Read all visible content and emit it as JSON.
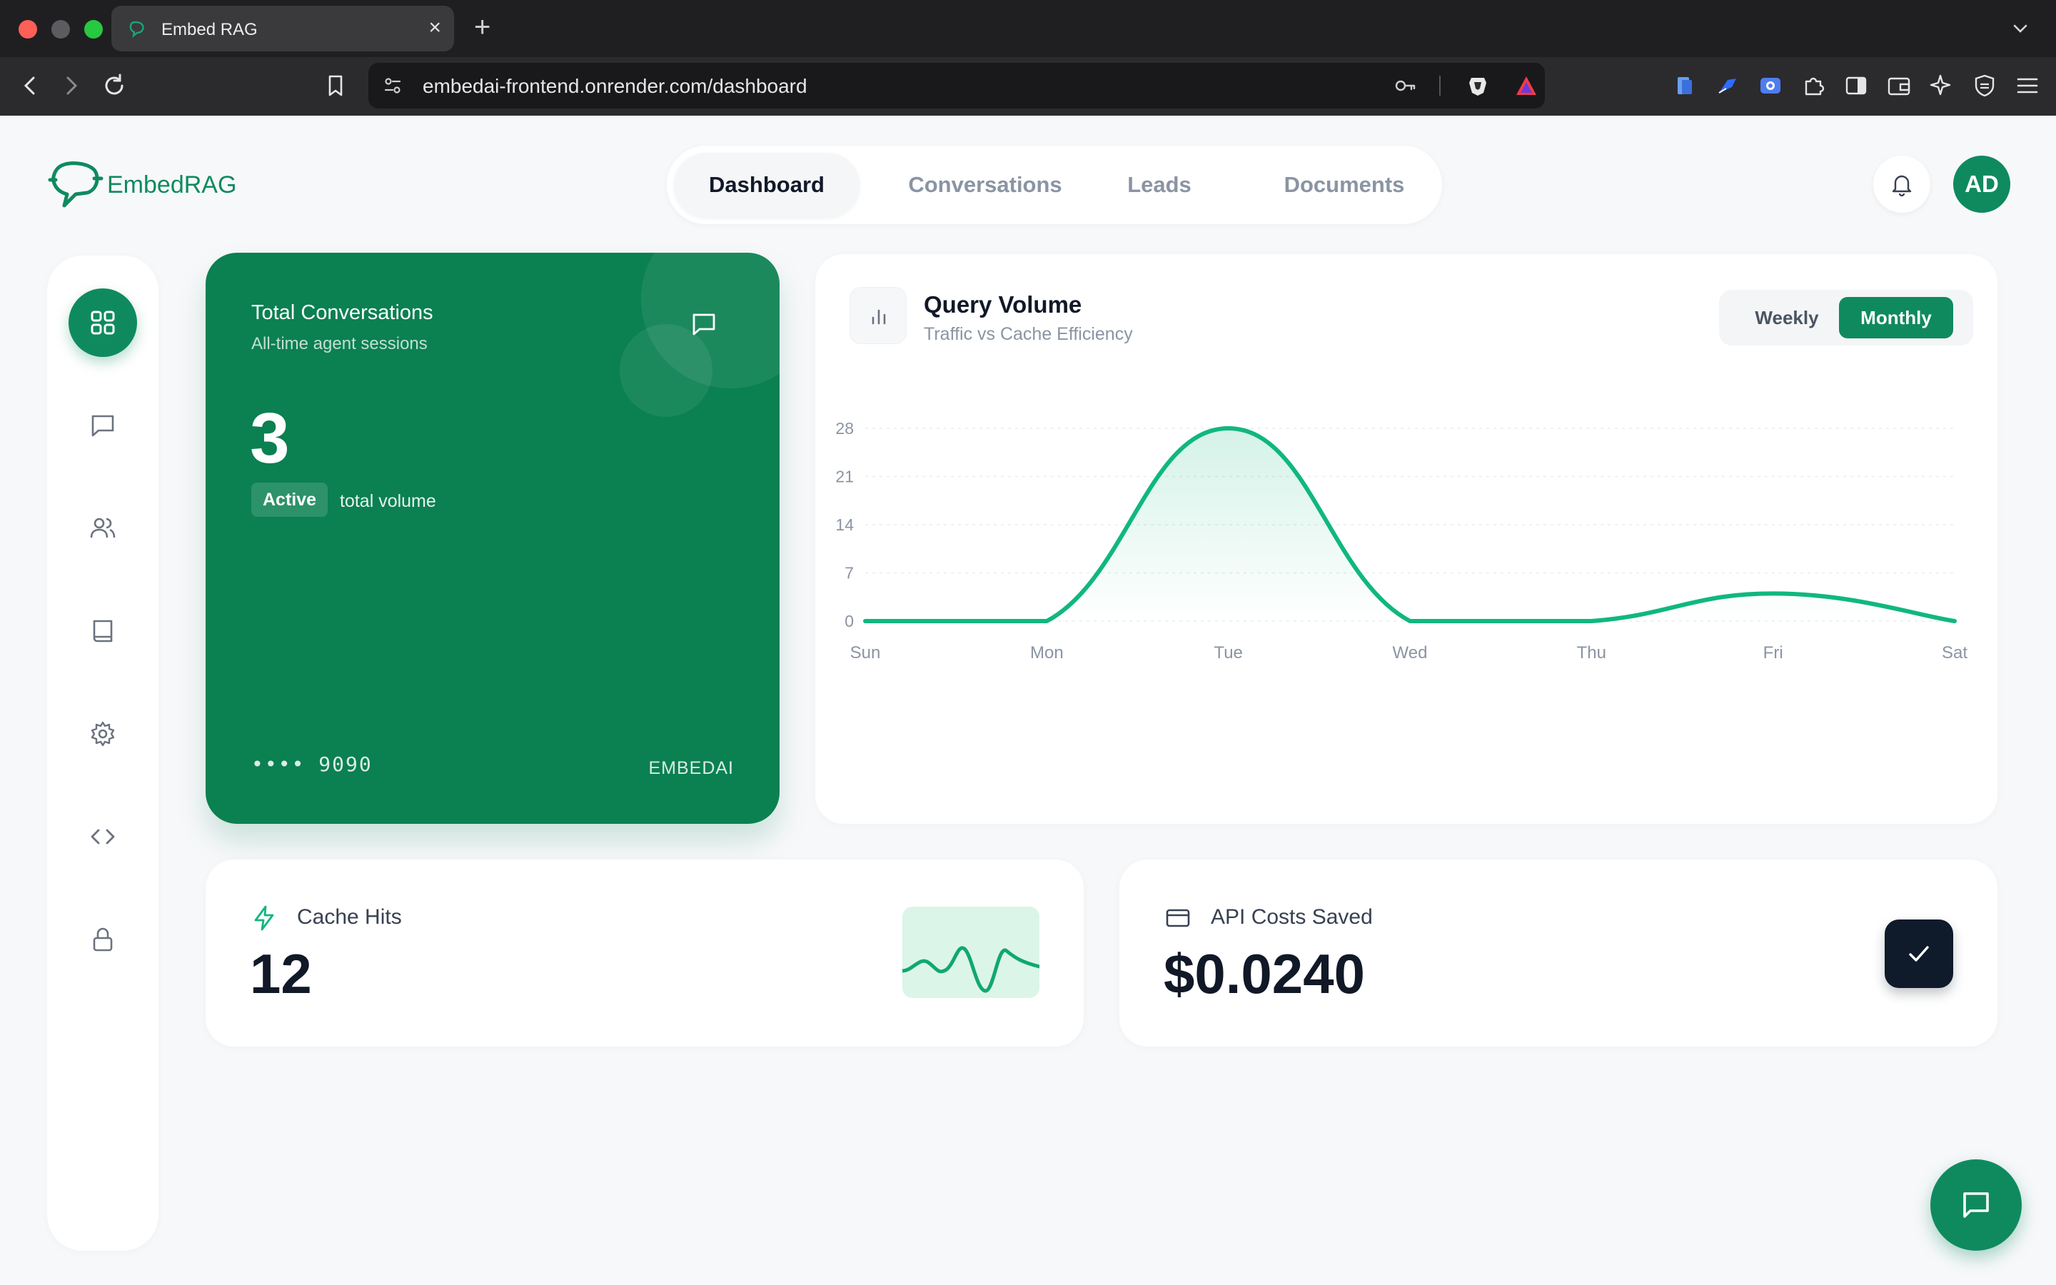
{
  "browser": {
    "tab_title": "Embed RAG",
    "tab_close": "×",
    "new_tab": "+",
    "url": "embedai-frontend.onrender.com/dashboard"
  },
  "brand": {
    "name": "EmbedRAG",
    "accent": "#0f8a5f"
  },
  "topnav": {
    "tabs": [
      {
        "label": "Dashboard",
        "active": true
      },
      {
        "label": "Conversations",
        "active": false
      },
      {
        "label": "Leads",
        "active": false
      },
      {
        "label": "Documents",
        "active": false
      }
    ]
  },
  "user": {
    "initials": "AD"
  },
  "sidebar": {
    "items": [
      {
        "icon": "grid-icon",
        "active": true
      },
      {
        "icon": "chat-icon",
        "active": false
      },
      {
        "icon": "users-icon",
        "active": false
      },
      {
        "icon": "book-icon",
        "active": false
      },
      {
        "icon": "gear-icon",
        "active": false
      },
      {
        "icon": "code-icon",
        "active": false
      },
      {
        "icon": "lock-icon",
        "active": false
      }
    ]
  },
  "conversations_card": {
    "title": "Total Conversations",
    "subtitle": "All-time agent sessions",
    "value": "3",
    "badge": "Active",
    "badge_note": "total volume",
    "card_number": "•••• 9090",
    "brand": "EMBEDAI"
  },
  "query_volume": {
    "title": "Query Volume",
    "subtitle": "Traffic vs Cache Efficiency",
    "toggle": {
      "weekly": "Weekly",
      "monthly": "Monthly",
      "selected": "Monthly"
    }
  },
  "chart_data": {
    "type": "area",
    "title": "Query Volume",
    "subtitle": "Traffic vs Cache Efficiency",
    "categories": [
      "Sun",
      "Mon",
      "Tue",
      "Wed",
      "Thu",
      "Fri",
      "Sat"
    ],
    "series": [
      {
        "values": [
          0,
          0,
          28,
          0,
          0,
          4,
          0
        ]
      }
    ],
    "yticks": [
      0,
      7,
      14,
      21,
      28
    ],
    "ylim": [
      0,
      28
    ],
    "grid": true,
    "line_color": "#10b77f"
  },
  "cache_hits": {
    "label": "Cache Hits",
    "value": "12"
  },
  "api_costs": {
    "label": "API Costs Saved",
    "value": "$0.0240"
  }
}
